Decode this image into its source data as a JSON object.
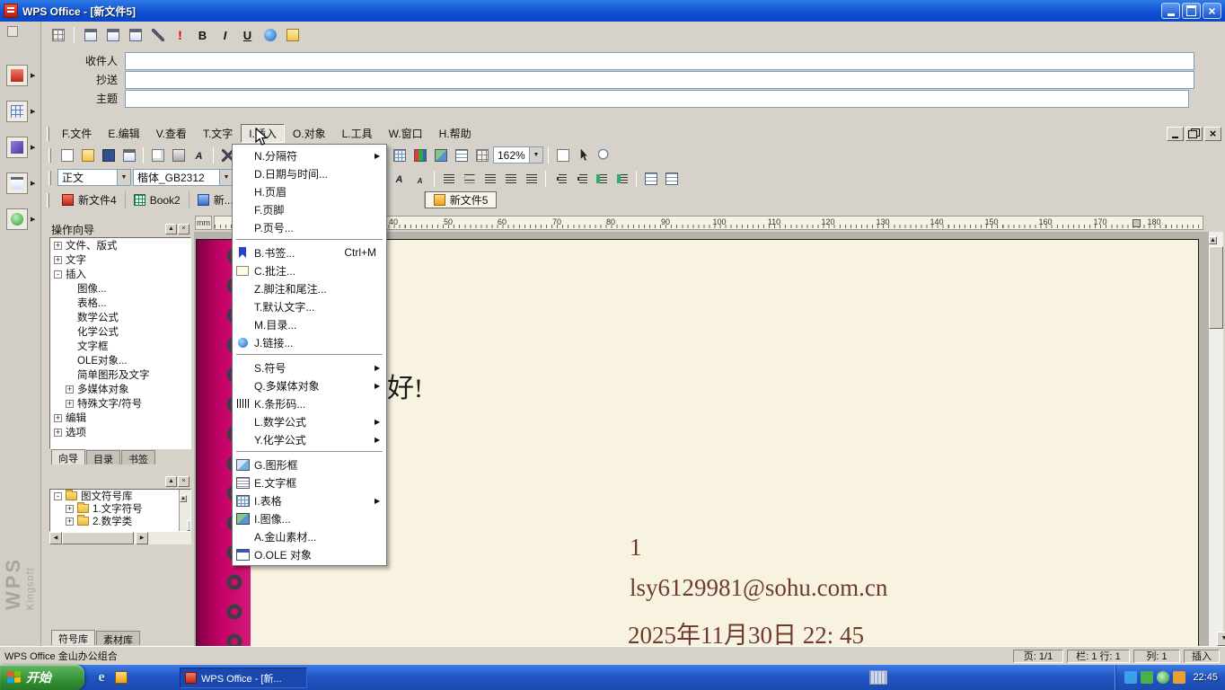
{
  "titlebar": {
    "title": "WPS Office - [新文件5]"
  },
  "mail": {
    "fields": [
      {
        "label": "收件人"
      },
      {
        "label": "抄送"
      },
      {
        "label": "主题"
      }
    ],
    "bold": "B",
    "italic": "I",
    "underline": "U",
    "priority": "!"
  },
  "menubar": {
    "items": [
      "F.文件",
      "E.编辑",
      "V.查看",
      "T.文字",
      "I.插入",
      "O.对象",
      "L.工具",
      "W.窗口",
      "H.帮助"
    ]
  },
  "insert_menu": {
    "items": [
      {
        "t": "N.分隔符"
      },
      {
        "t": "D.日期与时间..."
      },
      {
        "t": "H.页眉"
      },
      {
        "t": "F.页脚"
      },
      {
        "t": "P.页号..."
      },
      {
        "sep": true
      },
      {
        "t": "B.书签...",
        "k": "Ctrl+M"
      },
      {
        "t": "C.批注..."
      },
      {
        "t": "Z.脚注和尾注..."
      },
      {
        "t": "T.默认文字..."
      },
      {
        "t": "M.目录..."
      },
      {
        "t": "J.链接..."
      },
      {
        "sep": true
      },
      {
        "t": "S.符号"
      },
      {
        "t": "Q.多媒体对象"
      },
      {
        "t": "K.条形码..."
      },
      {
        "t": "L.数学公式"
      },
      {
        "t": "Y.化学公式"
      },
      {
        "sep": true
      },
      {
        "t": "G.图形框"
      },
      {
        "t": "E.文字框"
      },
      {
        "t": "I.表格"
      },
      {
        "t": "I.图像..."
      },
      {
        "t": "A.金山素材..."
      },
      {
        "t": "O.OLE 对象"
      }
    ],
    "submenu_arrow": "▶"
  },
  "toolbar": {
    "zoom": "162%"
  },
  "format": {
    "style": "正文",
    "font": "楷体_GB2312"
  },
  "tabs": {
    "docs": [
      {
        "label": "新文件4"
      },
      {
        "label": "Book2"
      },
      {
        "label": "新..."
      },
      {
        "label": "新文件5"
      }
    ]
  },
  "ruler": {
    "unit": "mm",
    "numbers": [
      "40",
      "50",
      "60",
      "70",
      "80",
      "90",
      "100",
      "110",
      "120",
      "130",
      "140",
      "150",
      "160",
      "170",
      "180"
    ]
  },
  "wizard": {
    "title": "操作向导",
    "tree": [
      {
        "t": "文件、版式",
        "s": "+"
      },
      {
        "t": "文字",
        "s": "+"
      },
      {
        "t": "插入",
        "s": "-"
      },
      {
        "t": "图像..."
      },
      {
        "t": "表格..."
      },
      {
        "t": "数学公式"
      },
      {
        "t": "化学公式"
      },
      {
        "t": "文字框"
      },
      {
        "t": "OLE对象..."
      },
      {
        "t": "简单图形及文字"
      },
      {
        "t": "多媒体对象",
        "s": "+"
      },
      {
        "t": "特殊文字/符号",
        "s": "+"
      },
      {
        "t": "编辑",
        "s": "+"
      },
      {
        "t": "选项",
        "s": "+"
      }
    ],
    "tabs": [
      "向导",
      "目录",
      "书签"
    ]
  },
  "symbols": {
    "tree": [
      {
        "t": "图文符号库",
        "s": "-"
      },
      {
        "t": "1.文字符号",
        "s": "+"
      },
      {
        "t": "2.数学类",
        "s": "+"
      }
    ],
    "tabs": [
      "符号库",
      "素材库"
    ]
  },
  "page": {
    "line1": "好!",
    "line2": "1",
    "line3": "lsy6129981@sohu.com.cn",
    "line4": "2025年11月30日 22: 45"
  },
  "statusbar": {
    "app": "WPS Office 金山办公组合",
    "page": "页: 1/1",
    "line": "栏: 1 行: 1",
    "col": "列: 1",
    "mode": "插入"
  },
  "taskbar": {
    "start": "开始",
    "task": "WPS Office - [新...",
    "time": "22:45"
  },
  "brand": {
    "wps": "WPS",
    "kingsoft": "Kingsoft"
  }
}
